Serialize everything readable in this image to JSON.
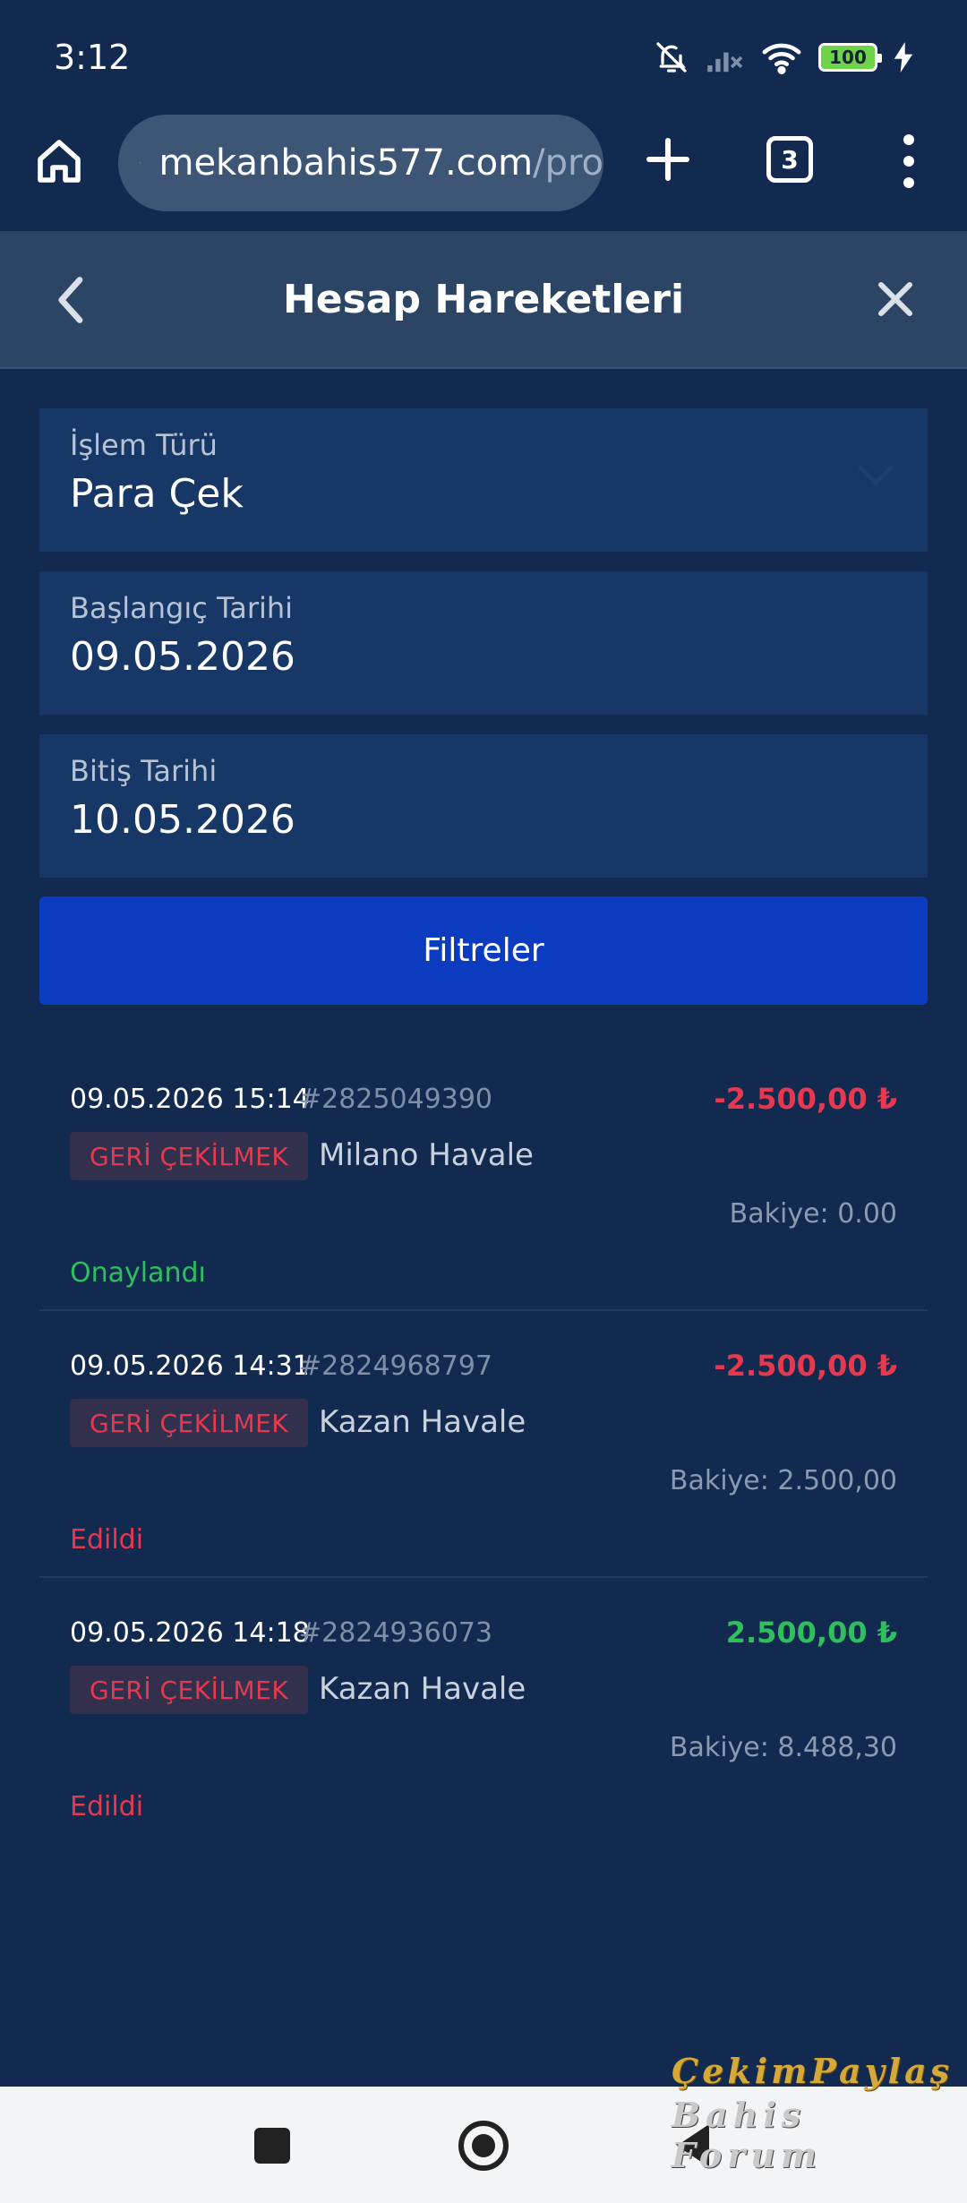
{
  "status_bar": {
    "time": "3:12",
    "battery": "100"
  },
  "browser": {
    "url_main": "mekanbahis577.com",
    "url_rest": "/pro",
    "tab_count": "3"
  },
  "header": {
    "title": "Hesap Hareketleri"
  },
  "filters": {
    "type_label": "İşlem Türü",
    "type_value": "Para Çek",
    "start_label": "Başlangıç Tarihi",
    "start_value": "09.05.2026",
    "end_label": "Bitiş Tarihi",
    "end_value": "10.05.2026",
    "button_label": "Filtreler"
  },
  "transactions": [
    {
      "datetime": "09.05.2026 15:14",
      "id": "#2825049390",
      "amount": "-2.500,00 ₺",
      "badge": "GERİ ÇEKİLMEK",
      "method": "Milano Havale",
      "balance": "Bakiye: 0.00",
      "status": "Onaylandı"
    },
    {
      "datetime": "09.05.2026 14:31",
      "id": "#2824968797",
      "amount": "-2.500,00 ₺",
      "badge": "GERİ ÇEKİLMEK",
      "method": "Kazan Havale",
      "balance": "Bakiye: 2.500,00",
      "status": "Edildi"
    },
    {
      "datetime": "09.05.2026 14:18",
      "id": "#2824936073",
      "amount": "2.500,00 ₺",
      "badge": "GERİ ÇEKİLMEK",
      "method": "Kazan Havale",
      "balance": "Bakiye: 8.488,30",
      "status": "Edildi"
    }
  ],
  "watermark": {
    "line1": "ÇekimPaylaş",
    "line2": "Bahis Forum"
  },
  "colors": {
    "background": "#122a4f",
    "field_bg": "#173767",
    "button_bg": "#0b3cbf",
    "negative": "#e6394f",
    "positive": "#2fbf5e"
  }
}
